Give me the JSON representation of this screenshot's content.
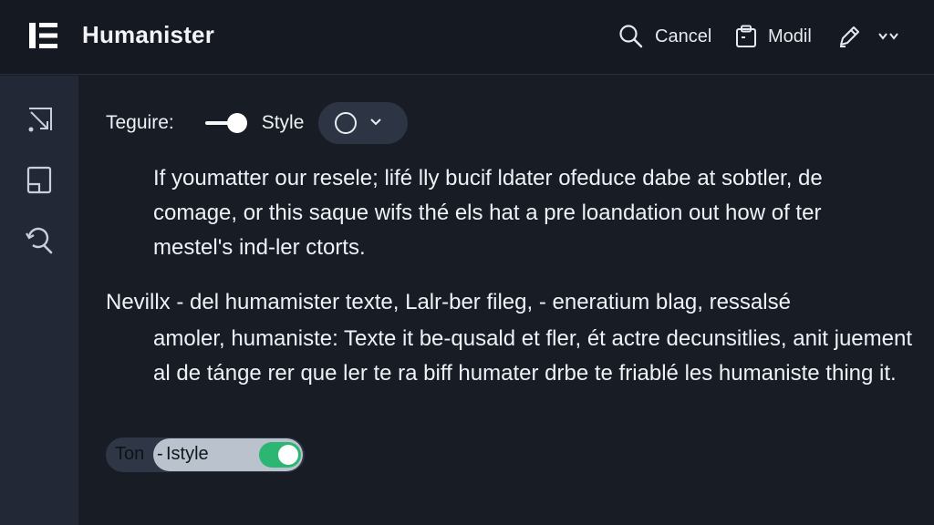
{
  "header": {
    "app_title": "Humanister",
    "cancel_label": "Cancel",
    "modil_label": "Modil",
    "icons": [
      "menu-logo-icon",
      "search-icon",
      "clipboard-icon",
      "pen-icon",
      "chevron-down-icon"
    ]
  },
  "sidebar": {
    "items": [
      {
        "icon": "expand-edit-icon"
      },
      {
        "icon": "document-icon"
      },
      {
        "icon": "search-refresh-icon"
      }
    ]
  },
  "main": {
    "feature_label": "Teguire:",
    "feature_toggle_on": true,
    "style_label": "Style",
    "paragraph1": "If youmatter our resele; lifé lly bucif ldater ofeduce dabe at sobtler, de comage, or this saque wifs thé els hat a pre loandation out how of ter mestel's ind-ler ctorts.",
    "paragraph2_first": "Nevillx - del humamister texte, Lalr-ber fileg, - eneratium blag, ressalsé",
    "paragraph2_rest": "amoler, humaniste: Texte it be-qusald et fler, ét actre decunsitlies, anit juement al de tánge rer que ler te ra biff humater drbe te friablé les humaniste thing it.",
    "bottom_toggle": {
      "left_text": "Ton",
      "separator": "-",
      "label": "Istyle",
      "on": true
    }
  },
  "colors": {
    "topbar_bg": "#151922",
    "sidebar_bg": "#222836",
    "main_bg": "#181c25",
    "toggle_on": "#2bb673"
  }
}
